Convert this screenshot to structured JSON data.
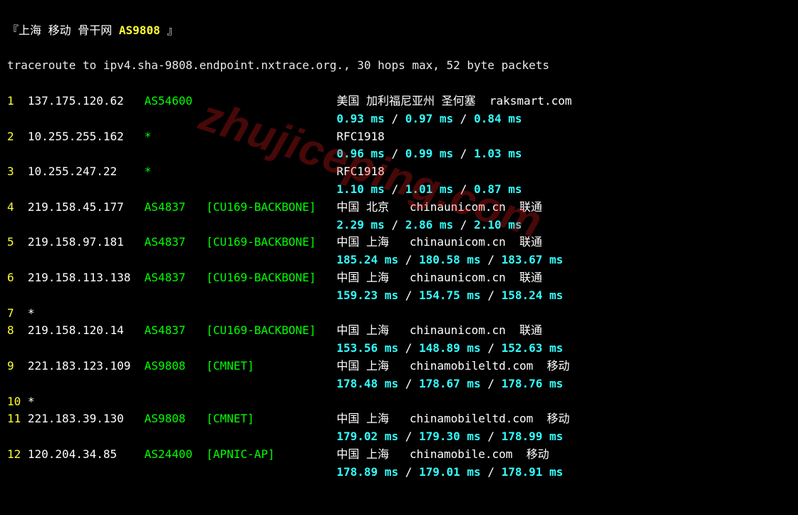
{
  "header": {
    "prefix": "『上海 移动 骨干网 ",
    "asn": "AS9808",
    "suffix": " 』"
  },
  "cmd": "traceroute to ipv4.sha-9808.endpoint.nxtrace.org., 30 hops max, 52 byte packets",
  "hops": [
    {
      "n": "1",
      "ip": "137.175.120.62",
      "asn": "AS54600",
      "netname": "",
      "loc": "美国 加利福尼亚州 圣何塞  raksmart.com",
      "rtt": [
        "0.93 ms",
        "0.97 ms",
        "0.84 ms"
      ]
    },
    {
      "n": "2",
      "ip": "10.255.255.162",
      "asn": "*",
      "netname": "",
      "loc": "RFC1918",
      "rtt": [
        "0.96 ms",
        "0.99 ms",
        "1.03 ms"
      ]
    },
    {
      "n": "3",
      "ip": "10.255.247.22",
      "asn": "*",
      "netname": "",
      "loc": "RFC1918",
      "rtt": [
        "1.10 ms",
        "1.01 ms",
        "0.87 ms"
      ]
    },
    {
      "n": "4",
      "ip": "219.158.45.177",
      "asn": "AS4837",
      "netname": "[CU169-BACKBONE]",
      "loc": "中国 北京   chinaunicom.cn  联通",
      "rtt": [
        "2.29 ms",
        "2.86 ms",
        "2.10 ms"
      ]
    },
    {
      "n": "5",
      "ip": "219.158.97.181",
      "asn": "AS4837",
      "netname": "[CU169-BACKBONE]",
      "loc": "中国 上海   chinaunicom.cn  联通",
      "rtt": [
        "185.24 ms",
        "180.58 ms",
        "183.67 ms"
      ]
    },
    {
      "n": "6",
      "ip": "219.158.113.138",
      "asn": "AS4837",
      "netname": "[CU169-BACKBONE]",
      "loc": "中国 上海   chinaunicom.cn  联通",
      "rtt": [
        "159.23 ms",
        "154.75 ms",
        "158.24 ms"
      ]
    },
    {
      "n": "7",
      "ip": "*",
      "asn": "",
      "netname": "",
      "loc": "",
      "rtt": []
    },
    {
      "n": "8",
      "ip": "219.158.120.14",
      "asn": "AS4837",
      "netname": "[CU169-BACKBONE]",
      "loc": "中国 上海   chinaunicom.cn  联通",
      "rtt": [
        "153.56 ms",
        "148.89 ms",
        "152.63 ms"
      ]
    },
    {
      "n": "9",
      "ip": "221.183.123.109",
      "asn": "AS9808",
      "netname": "[CMNET]",
      "loc": "中国 上海   chinamobileltd.com  移动",
      "rtt": [
        "178.48 ms",
        "178.67 ms",
        "178.76 ms"
      ]
    },
    {
      "n": "10",
      "ip": "*",
      "asn": "",
      "netname": "",
      "loc": "",
      "rtt": []
    },
    {
      "n": "11",
      "ip": "221.183.39.130",
      "asn": "AS9808",
      "netname": "[CMNET]",
      "loc": "中国 上海   chinamobileltd.com  移动",
      "rtt": [
        "179.02 ms",
        "179.30 ms",
        "178.99 ms"
      ]
    },
    {
      "n": "12",
      "ip": "120.204.34.85",
      "asn": "AS24400",
      "netname": "[APNIC-AP]",
      "loc": "中国 上海   chinamobile.com  移动",
      "rtt": [
        "178.89 ms",
        "179.01 ms",
        "178.91 ms"
      ]
    }
  ],
  "watermark": "zhujiceping.com"
}
